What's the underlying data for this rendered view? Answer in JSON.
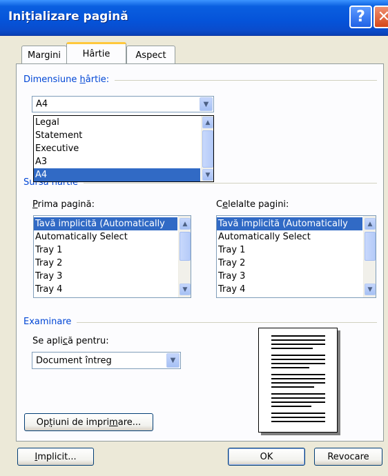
{
  "window": {
    "title": "Inițializare pagină",
    "help_glyph": "?",
    "close_glyph": "✕"
  },
  "tabs": [
    {
      "label": "Margini"
    },
    {
      "label": "Hârtie"
    },
    {
      "label": "Aspect"
    }
  ],
  "paper_size": {
    "group_label_pre": "Dimensiune ",
    "group_label_u": "h",
    "group_label_post": "ârtie:",
    "selected": "A4",
    "dropdown_options": [
      "Legal",
      "Statement",
      "Executive",
      "A3",
      "A4"
    ],
    "dropdown_selected_index": 4
  },
  "paper_source": {
    "group_label": "Sursă hârtie",
    "first_page": {
      "label_u": "P",
      "label_rest": "rima pagină:",
      "items": [
        "Tavă implicită (Automatically",
        "Automatically Select",
        "Tray 1",
        "Tray 2",
        "Tray 3",
        "Tray 4"
      ],
      "selected_index": 0
    },
    "other_pages": {
      "label_pre": "C",
      "label_u": "e",
      "label_rest": "lelalte pagini:",
      "items": [
        "Tavă implicită (Automatically",
        "Automatically Select",
        "Tray 1",
        "Tray 2",
        "Tray 3",
        "Tray 4"
      ],
      "selected_index": 0
    }
  },
  "preview": {
    "group_label": "Examinare",
    "apply_label_pre": "Se apli",
    "apply_label_u": "c",
    "apply_label_rest": "ă pentru:",
    "apply_value": "Document întreg"
  },
  "buttons": {
    "print_options_pre": "Op",
    "print_options_u": "ț",
    "print_options_mid": "iuni de impri",
    "print_options_u2": "m",
    "print_options_rest": "are...",
    "default_u": "I",
    "default_rest": "mplicit...",
    "ok": "OK",
    "cancel": "Revocare"
  }
}
